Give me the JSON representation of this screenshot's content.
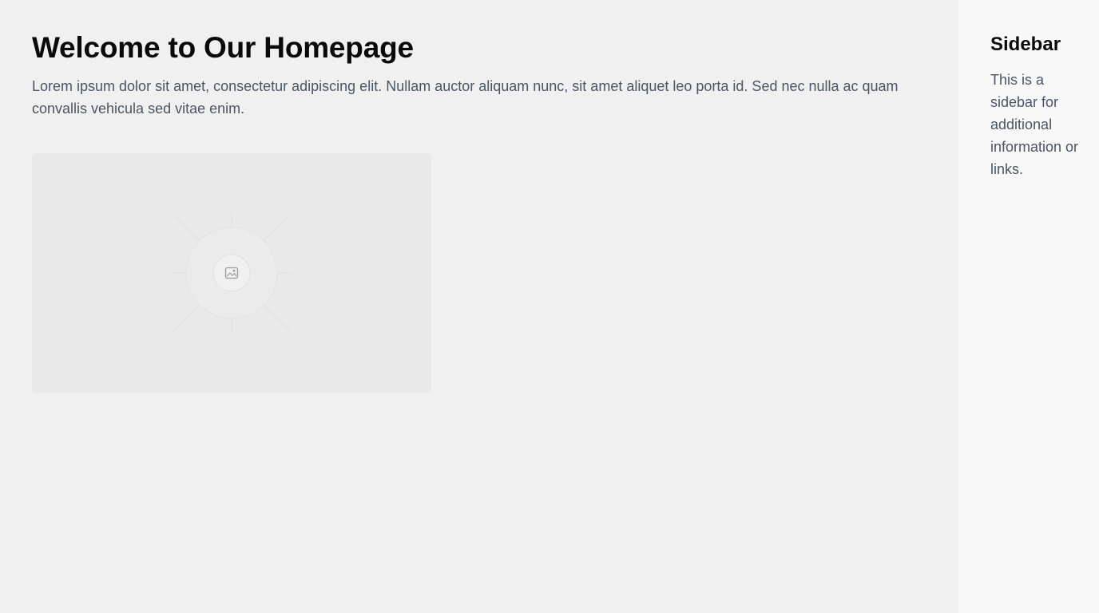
{
  "main": {
    "title": "Welcome to Our Homepage",
    "body": "Lorem ipsum dolor sit amet, consectetur adipiscing elit. Nullam auctor aliquam nunc, sit amet aliquet leo porta id. Sed nec nulla ac quam convallis vehicula sed vitae enim.",
    "image": {
      "icon": "image-icon"
    }
  },
  "sidebar": {
    "title": "Sidebar",
    "body": "This is a sidebar for additional information or links."
  }
}
